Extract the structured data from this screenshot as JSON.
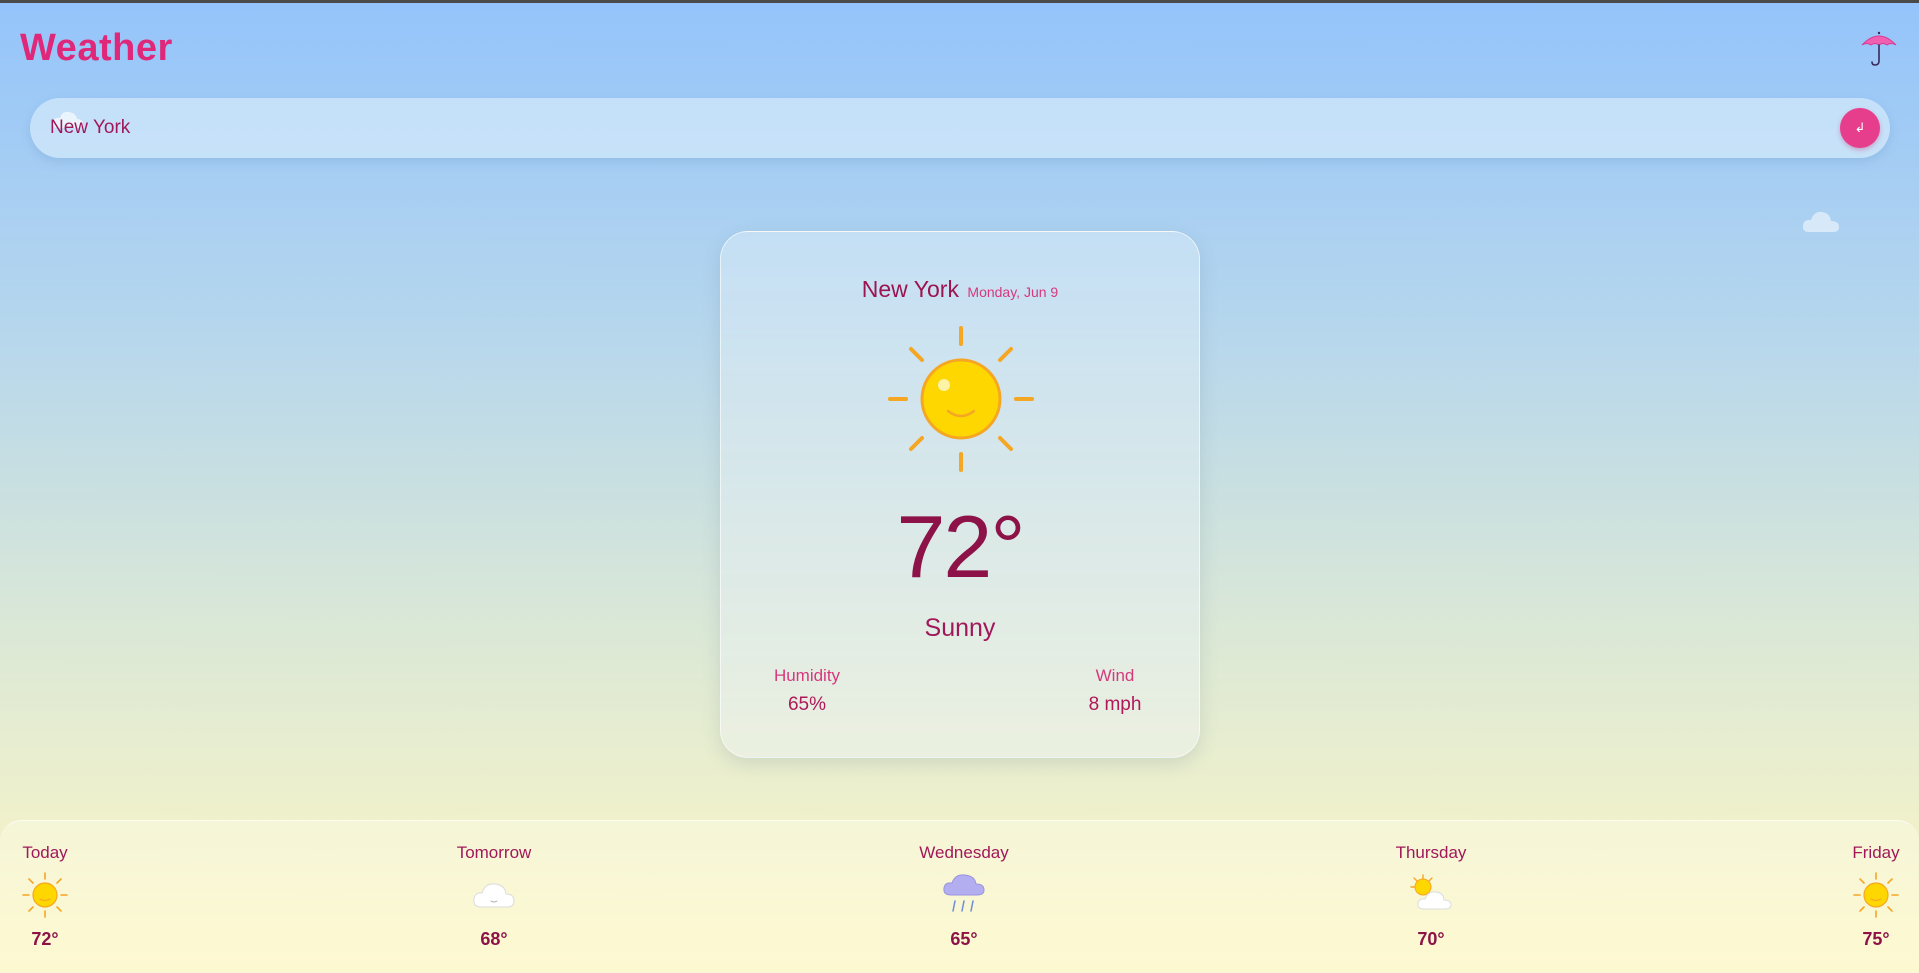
{
  "app": {
    "title": "Weather"
  },
  "search": {
    "value": "New York",
    "button_label": "↲"
  },
  "current": {
    "city": "New York",
    "date": "Monday, Jun 9",
    "temperature": "72°",
    "condition": "Sunny",
    "humidity_label": "Humidity",
    "humidity_value": "65%",
    "wind_label": "Wind",
    "wind_value": "8 mph"
  },
  "forecast": [
    {
      "day": "Today",
      "icon": "sun-icon",
      "temp": "72°"
    },
    {
      "day": "Tomorrow",
      "icon": "cloud-icon",
      "temp": "68°"
    },
    {
      "day": "Wednesday",
      "icon": "rain-cloud-icon",
      "temp": "65°"
    },
    {
      "day": "Thursday",
      "icon": "partly-cloudy-icon",
      "temp": "70°"
    },
    {
      "day": "Friday",
      "icon": "sun-icon",
      "temp": "75°"
    }
  ],
  "colors": {
    "accent": "#e0287a",
    "text_dark": "#8c1248",
    "sun": "#ffd700",
    "sun_rays": "#f5a623",
    "rain_cloud": "#b3aef0"
  }
}
